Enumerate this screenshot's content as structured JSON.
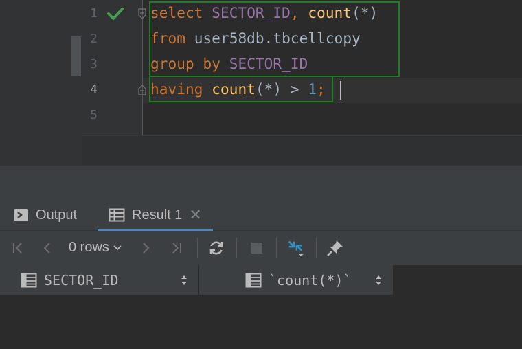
{
  "editor": {
    "line_numbers": [
      "1",
      "2",
      "3",
      "4",
      "5"
    ],
    "lines": [
      [
        {
          "t": "select",
          "c": "kw"
        },
        {
          "t": " "
        },
        {
          "t": "SECTOR_ID",
          "c": "col"
        },
        {
          "t": ", ",
          "c": "kw"
        },
        {
          "t": "count",
          "c": "fn"
        },
        {
          "t": "(*)"
        }
      ],
      [
        {
          "t": "from",
          "c": "kw"
        },
        {
          "t": " user58db.tbcellcopy"
        }
      ],
      [
        {
          "t": "group by",
          "c": "kw"
        },
        {
          "t": " "
        },
        {
          "t": "SECTOR_ID",
          "c": "col"
        }
      ],
      [
        {
          "t": "having",
          "c": "kw"
        },
        {
          "t": " "
        },
        {
          "t": "count",
          "c": "fn"
        },
        {
          "t": "(*) > "
        },
        {
          "t": "1",
          "c": "num"
        },
        {
          "t": ";",
          "c": "kw"
        }
      ]
    ],
    "status_icon": "check-icon",
    "colors": {
      "keyword": "#cc7832",
      "column": "#9876aa",
      "function": "#ffc66d",
      "number": "#6897bb",
      "text": "#a9b7c6",
      "selection_border": "#1f7f23"
    }
  },
  "tabs": [
    {
      "label": "Output",
      "icon": "console-icon",
      "active": false
    },
    {
      "label": "Result 1",
      "icon": "table-icon",
      "active": true,
      "closable": true
    }
  ],
  "toolbar": {
    "rows_label": "0 rows",
    "buttons": [
      "first-page-icon",
      "previous-page-icon",
      "next-page-icon",
      "last-page-icon",
      "refresh-icon",
      "stop-icon",
      "compare-icon",
      "pin-icon"
    ]
  },
  "grid": {
    "columns": [
      {
        "label": "SECTOR_ID",
        "icon": "column-icon"
      },
      {
        "label": "`count(*)`",
        "icon": "column-icon"
      }
    ],
    "rows": []
  },
  "accent": "#4a88c7"
}
